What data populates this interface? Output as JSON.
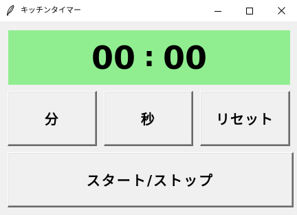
{
  "window": {
    "title": "キッチンタイマー"
  },
  "timer": {
    "minutes": "00",
    "separator": ":",
    "seconds": "00",
    "background": "#90ee90"
  },
  "buttons": {
    "minutes_label": "分",
    "seconds_label": "秒",
    "reset_label": "リセット",
    "start_stop_label": "スタート/ストップ"
  },
  "icons": {
    "app": "feather-icon",
    "minimize": "minimize-icon",
    "maximize": "maximize-icon",
    "close": "close-icon"
  }
}
